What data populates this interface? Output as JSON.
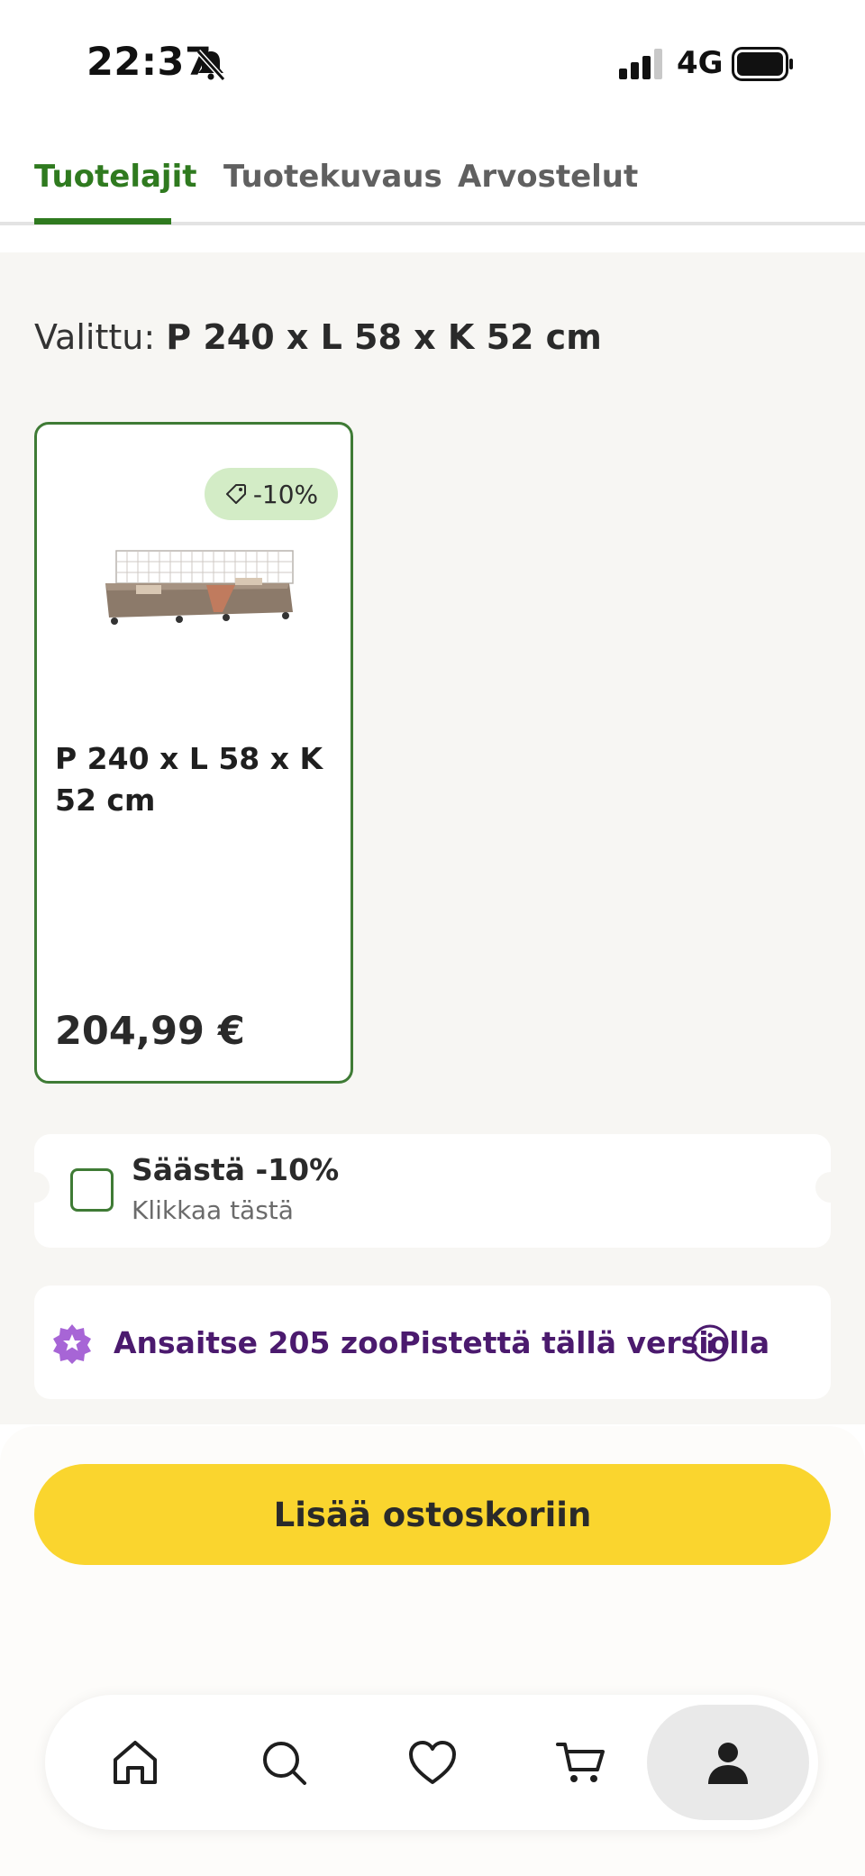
{
  "status_bar": {
    "time": "22:37",
    "network": "4G"
  },
  "tabs": [
    {
      "label": "Tuotelajit",
      "active": true
    },
    {
      "label": "Tuotekuvaus",
      "active": false
    },
    {
      "label": "Arvostelut",
      "active": false
    }
  ],
  "selection": {
    "prefix": "Valittu:",
    "value": "P 240 x L 58 x K 52 cm"
  },
  "variant": {
    "discount": "-10%",
    "name": "P 240 x L 58 x K 52 cm",
    "price": "204,99 €",
    "image": "rabbit-cage-product-image"
  },
  "coupon": {
    "title": "Säästä -10%",
    "subtitle": "Klikkaa tästä",
    "checked": false
  },
  "points": {
    "text": "Ansaitse 205 zooPistettä tällä versiolla"
  },
  "cart_button": {
    "label": "Lisää ostoskoriin"
  },
  "nav": [
    {
      "icon": "home-icon"
    },
    {
      "icon": "search-icon"
    },
    {
      "icon": "heart-icon"
    },
    {
      "icon": "cart-icon"
    },
    {
      "icon": "profile-icon",
      "active": true
    }
  ],
  "colors": {
    "brand_green": "#2f7a1f",
    "cta_yellow": "#fad52e",
    "points_purple": "#4b1a6e",
    "badge_green": "#d3ecc6"
  }
}
